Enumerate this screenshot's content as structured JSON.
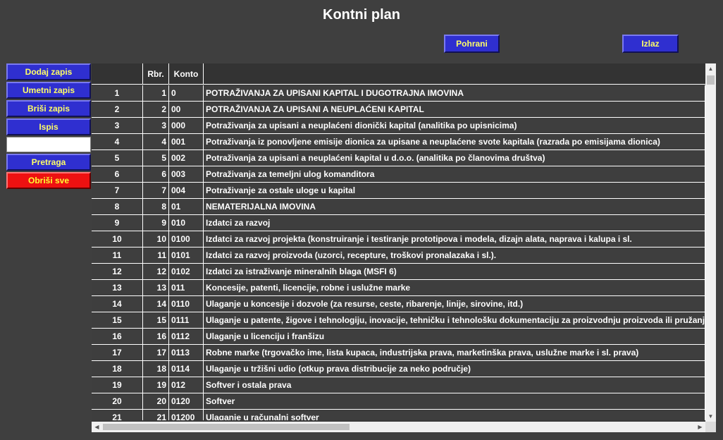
{
  "page": {
    "title": "Kontni plan"
  },
  "toolbar": {
    "save_label": "Pohrani",
    "exit_label": "Izlaz"
  },
  "sidebar": {
    "add_label": "Dodaj zapis",
    "insert_label": "Umetni zapis",
    "delete_label": "Briši zapis",
    "print_label": "Ispis",
    "search_value": "",
    "search_label": "Pretraga",
    "clear_all_label": "Obriši sve"
  },
  "grid": {
    "headers": [
      "",
      "Rbr.",
      "Konto",
      ""
    ],
    "rows": [
      [
        "1",
        "1",
        "0",
        "POTRAŽIVANJA ZA UPISANI KAPITAL I DUGOTRAJNA IMOVINA"
      ],
      [
        "2",
        "2",
        "00",
        "POTRAŽIVANJA ZA UPISANI A NEUPLAĆENI KAPITAL"
      ],
      [
        "3",
        "3",
        "000",
        "Potraživanja za upisani a neuplaćeni dionički kapital (analitika po upisnicima)"
      ],
      [
        "4",
        "4",
        "001",
        "Potraživanja iz ponovljene emisije dionica za upisane a neuplaćene svote kapitala (razrada po emisijama dionica)"
      ],
      [
        "5",
        "5",
        "002",
        "Potraživanja za upisani a neuplaćeni kapital u d.o.o. (analitika po članovima društva)"
      ],
      [
        "6",
        "6",
        "003",
        "Potraživanja za temeljni ulog komanditora"
      ],
      [
        "7",
        "7",
        "004",
        "Potraživanje za ostale uloge u kapital"
      ],
      [
        "8",
        "8",
        "01",
        "NEMATERIJALNA IMOVINA"
      ],
      [
        "9",
        "9",
        "010",
        "Izdatci za razvoj"
      ],
      [
        "10",
        "10",
        "0100",
        "Izdatci za razvoj projekta (konstruiranje i testiranje prototipova i modela, dizajn alata, naprava i kalupa i sl."
      ],
      [
        "11",
        "11",
        "0101",
        "Izdatci za razvoj proizvoda (uzorci, recepture, troškovi pronalazaka i sl.)."
      ],
      [
        "12",
        "12",
        "0102",
        "Izdatci za istraživanje mineralnih blaga (MSFI 6)"
      ],
      [
        "13",
        "13",
        "011",
        "Koncesije, patenti, licencije, robne i uslužne marke"
      ],
      [
        "14",
        "14",
        "0110",
        "Ulaganje u koncesije i dozvole (za resurse, ceste, ribarenje, linije, sirovine, itd.)"
      ],
      [
        "15",
        "15",
        "0111",
        "Ulaganje u patente, žigove i tehnologiju, inovacije, tehničku i tehnološku dokumentaciju za proizvodnju proizvoda ili pružanje"
      ],
      [
        "16",
        "16",
        "0112",
        "Ulaganje u licenciju i franšizu"
      ],
      [
        "17",
        "17",
        "0113",
        "Robne marke (trgovačko ime, lista kupaca, industrijska prava, marketinška prava, uslužne marke i sl. prava)"
      ],
      [
        "18",
        "18",
        "0114",
        "Ulaganje u tržišni udio (otkup prava distribucije za neko područje)"
      ],
      [
        "19",
        "19",
        "012",
        "Softver i ostala prava"
      ],
      [
        "20",
        "20",
        "0120",
        "Softver"
      ],
      [
        "21",
        "21",
        "01200",
        "Ulaganje u računalni softver"
      ]
    ]
  },
  "scroll": {
    "up_arrow": "▲",
    "down_arrow": "▼",
    "left_arrow": "◀",
    "right_arrow": "▶"
  }
}
